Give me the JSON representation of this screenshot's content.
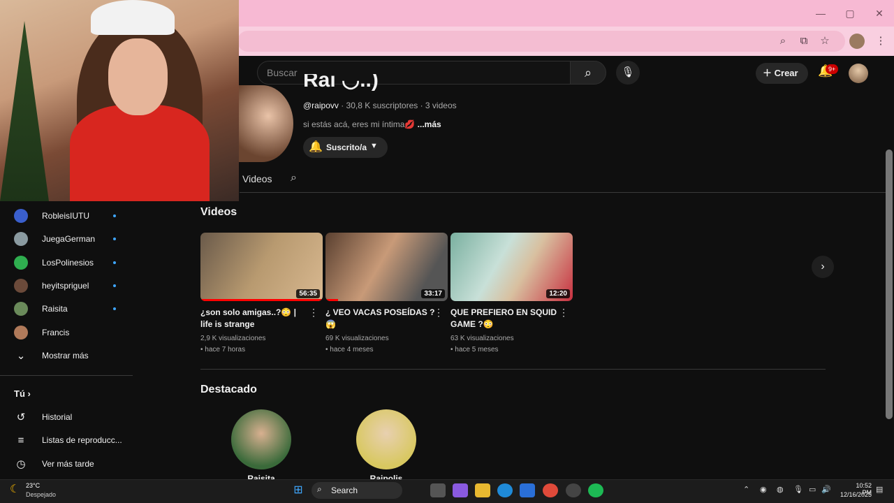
{
  "browser": {
    "window_controls": [
      "—",
      "▢",
      "✕"
    ]
  },
  "header": {
    "search_placeholder": "Buscar",
    "create_label": "Crear",
    "notif_badge": "9+"
  },
  "channel": {
    "name": "Raı ◡..)",
    "handle": "@raipovv",
    "meta": " · 30,8 K suscriptores · 3 videos",
    "description": "si estás acá, eres mi íntima💋",
    "more": " ...más",
    "subscribe_label": "Suscrito/a",
    "tab_videos": "Videos"
  },
  "sidebar": {
    "subscriptions": [
      {
        "label": "RobleisIUTU",
        "color": "#3a5fcd",
        "new": true
      },
      {
        "label": "JuegaGerman",
        "color": "#8a9aa0",
        "new": true
      },
      {
        "label": "LosPolinesios",
        "color": "#2fae4f",
        "new": true
      },
      {
        "label": "heyitspriguel",
        "color": "#6b4a3a",
        "new": true
      },
      {
        "label": "Raisita",
        "color": "#6a8a5a",
        "new": true
      },
      {
        "label": "Francis",
        "color": "#b07a5a",
        "new": false
      }
    ],
    "show_more": "Mostrar más",
    "you_label": "Tú",
    "you_items": [
      {
        "label": "Historial",
        "icon": "history-icon",
        "glyph": "↺"
      },
      {
        "label": "Listas de reproducc...",
        "icon": "playlist-icon",
        "glyph": "≡"
      },
      {
        "label": "Ver más tarde",
        "icon": "clock-icon",
        "glyph": "◷"
      }
    ]
  },
  "videos_section": {
    "title": "Videos",
    "items": [
      {
        "title": "¿son solo amigas..?😳 | life is strange",
        "views": "2,9 K visualizaciones",
        "age": "• hace 7 horas",
        "duration": "56:35",
        "progress": 1.0,
        "thumb": "linear-gradient(120deg,#6a5a4a,#b89a70 50%,#d8b890)"
      },
      {
        "title": "¿ VEO VACAS POSEÍDAS ?😱",
        "views": "69 K visualizaciones",
        "age": "• hace 4 meses",
        "duration": "33:17",
        "progress": 0.1,
        "thumb": "linear-gradient(120deg,#5a4030,#c89a78 45%,#555 80%)"
      },
      {
        "title": "QUE PREFIERO EN SQUID GAME ?😳",
        "views": "63 K visualizaciones",
        "age": "• hace 5 meses",
        "duration": "12:20",
        "progress": 0.0,
        "thumb": "linear-gradient(120deg,#7ab0a0,#c8e0d8 40%,#d8c0a0 60%,#c83040)"
      }
    ]
  },
  "featured": {
    "title": "Destacado",
    "items": [
      {
        "name": "Raisita",
        "color": "radial-gradient(circle at 50% 40%,#d8b090,#3a6a3a 70%)"
      },
      {
        "name": "Raipolis",
        "color": "radial-gradient(circle at 50% 40%,#e8d0b0,#d8c860 70%)"
      }
    ]
  },
  "taskbar": {
    "temp": "23°C",
    "weather": "Despejado",
    "search": "Search",
    "time": "10:52 PM",
    "date": "12/16/2025"
  }
}
